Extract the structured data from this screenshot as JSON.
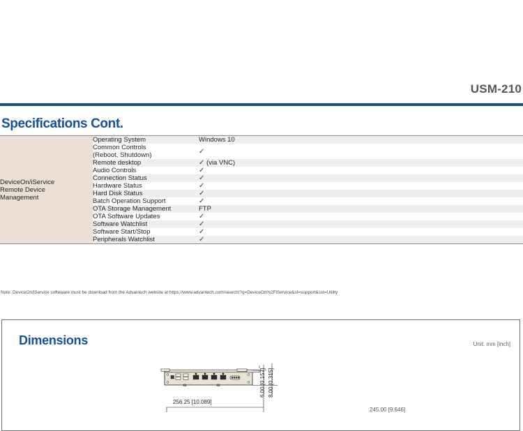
{
  "header": {
    "model": "USM-210"
  },
  "section": {
    "title": "Specifications Cont."
  },
  "spec_table": {
    "category": "DeviceOn/iService\nRemote Device\nManagement",
    "rows": [
      {
        "label": "Operating System",
        "value": "Windows 10",
        "check": false
      },
      {
        "label": "Common Controls\n(Reboot, Shutdown)",
        "value": "",
        "check": true
      },
      {
        "label": "Remote desktop",
        "value": "(via VNC)",
        "check": true
      },
      {
        "label": "Audio Controls",
        "value": "",
        "check": true
      },
      {
        "label": "Connection Status",
        "value": "",
        "check": true
      },
      {
        "label": "Hardware Status",
        "value": "",
        "check": true
      },
      {
        "label": "Hard Disk Status",
        "value": "",
        "check": true
      },
      {
        "label": "Batch Operation Support",
        "value": "",
        "check": true
      },
      {
        "label": "OTA Storage Management",
        "value": "FTP",
        "check": false
      },
      {
        "label": "OTA Software Updates",
        "value": "",
        "check": true
      },
      {
        "label": "Software Watchlist",
        "value": "",
        "check": true
      },
      {
        "label": "Software Start/Stop",
        "value": "",
        "check": true
      },
      {
        "label": "Peripherals Watchlist",
        "value": "",
        "check": true
      }
    ],
    "checkmark": "✓"
  },
  "note": {
    "text": "Note: DeviceOn/iService softeware must be download from the Advantech website at https://www.advantech.com/search/?q=DeviceOn%2FiService&st=support&sst=Utility"
  },
  "dimensions": {
    "title": "Dimensions",
    "unit": "Unit: mm [inch]",
    "labels": {
      "width_top": "256.25 [10.089]",
      "width_right": "245.00 [9.646]",
      "height_inner": "6.00 [0.157]",
      "height_outer": "8.00 [0.315]"
    }
  },
  "colors": {
    "brand_blue": "#14529e",
    "rule_blue": "#1f4e82",
    "category_beige": "#ece0d6",
    "row_gray": "#eeeeee",
    "model_gray": "#54565b"
  }
}
